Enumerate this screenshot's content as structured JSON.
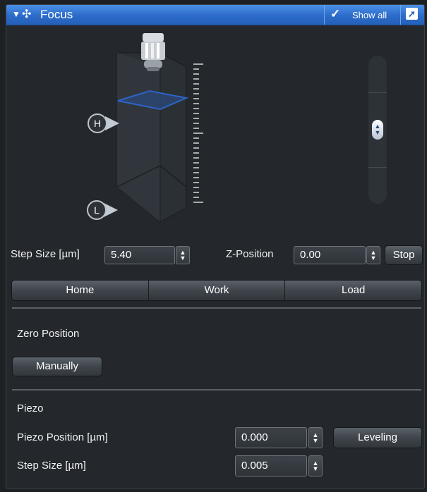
{
  "panel": {
    "title": "Focus",
    "show_all_label": "Show all"
  },
  "focus_visual": {
    "markers": [
      "H",
      "L"
    ]
  },
  "row_step": {
    "step_size_label": "Step Size [µm]",
    "step_size_value": "5.40",
    "z_position_label": "Z-Position",
    "z_position_value": "0.00",
    "stop_label": "Stop"
  },
  "positions": [
    "Home",
    "Work",
    "Load"
  ],
  "zero_position": {
    "heading": "Zero Position",
    "manually_label": "Manually"
  },
  "piezo": {
    "heading": "Piezo",
    "position_label": "Piezo Position [µm]",
    "position_value": "0.000",
    "leveling_label": "Leveling",
    "step_label": "Step Size [µm]",
    "step_value": "0.005"
  }
}
